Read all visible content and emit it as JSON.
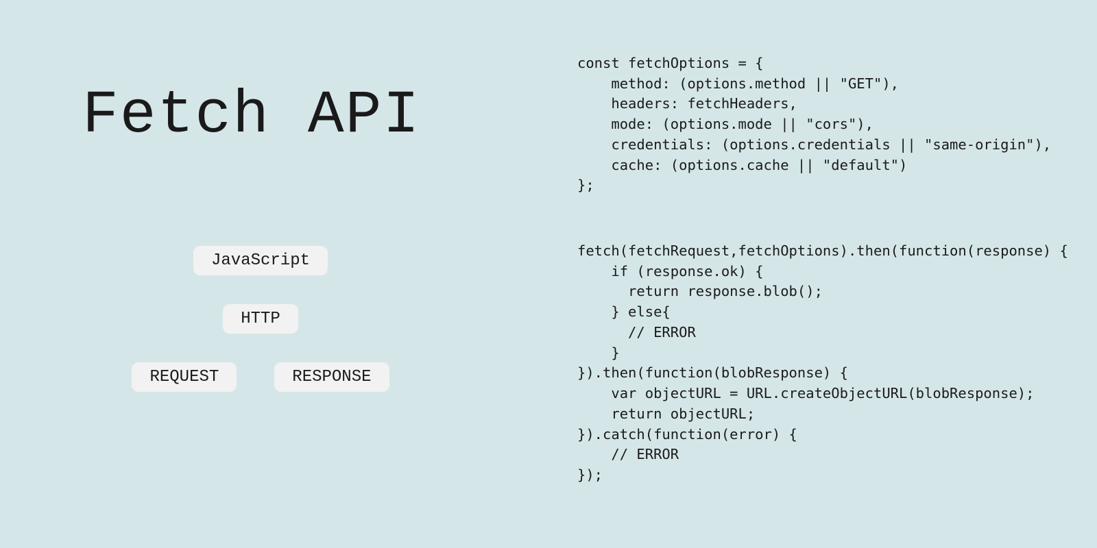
{
  "title": "Fetch API",
  "tags": {
    "row1": [
      "JavaScript"
    ],
    "row2": [
      "HTTP"
    ],
    "row3": [
      "REQUEST",
      "RESPONSE"
    ]
  },
  "code": {
    "block1": "const fetchOptions = {\n    method: (options.method || \"GET\"),\n    headers: fetchHeaders,\n    mode: (options.mode || \"cors\"),\n    credentials: (options.credentials || \"same-origin\"),\n    cache: (options.cache || \"default\")\n};",
    "block2": "fetch(fetchRequest,fetchOptions).then(function(response) {\n    if (response.ok) {\n      return response.blob();\n    } else{\n      // ERROR\n    }\n}).then(function(blobResponse) {\n    var objectURL = URL.createObjectURL(blobResponse);\n    return objectURL;\n}).catch(function(error) {\n    // ERROR\n});"
  }
}
